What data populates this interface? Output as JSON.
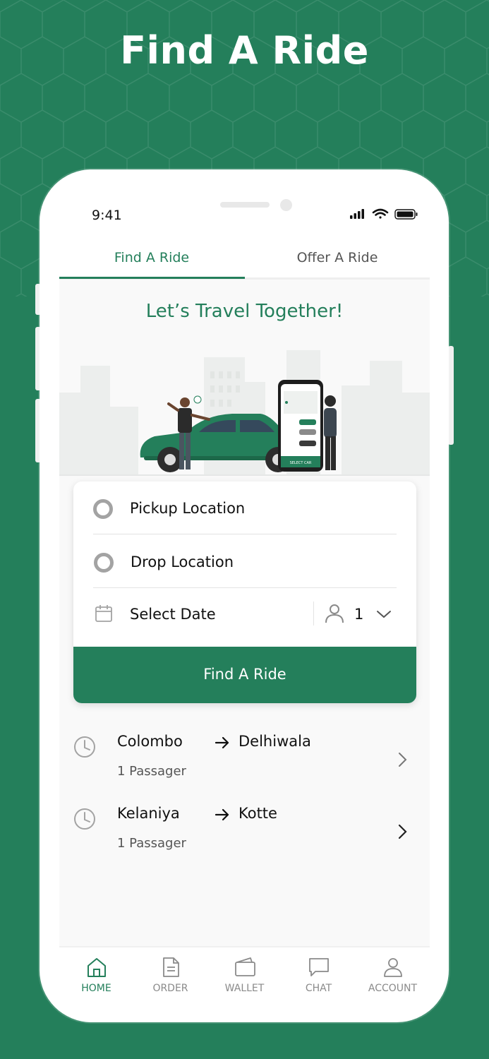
{
  "headline": "Find A Ride",
  "status_bar": {
    "time": "9:41"
  },
  "tabs": [
    {
      "label": "Find A Ride",
      "active": true
    },
    {
      "label": "Offer A Ride",
      "active": false
    }
  ],
  "tagline": "Let’s Travel Together!",
  "illustration": {
    "screen_text": "SELECT CAR"
  },
  "form": {
    "pickup_label": "Pickup Location",
    "drop_label": "Drop Location",
    "date_label": "Select Date",
    "passenger_count": "1",
    "button_label": "Find A Ride"
  },
  "recent_rides": [
    {
      "from": "Colombo",
      "to": "Delhiwala",
      "passengers": "1 Passager"
    },
    {
      "from": "Kelaniya",
      "to": "Kotte",
      "passengers": "1 Passager"
    }
  ],
  "nav": [
    {
      "label": "HOME",
      "icon": "home-icon",
      "active": true
    },
    {
      "label": "ORDER",
      "icon": "document-icon",
      "active": false
    },
    {
      "label": "WALLET",
      "icon": "wallet-icon",
      "active": false
    },
    {
      "label": "CHAT",
      "icon": "chat-icon",
      "active": false
    },
    {
      "label": "ACCOUNT",
      "icon": "user-icon",
      "active": false
    }
  ],
  "colors": {
    "brand_green": "#247f5b",
    "background": "#247f5b",
    "muted_gray": "#a3a3a3"
  }
}
